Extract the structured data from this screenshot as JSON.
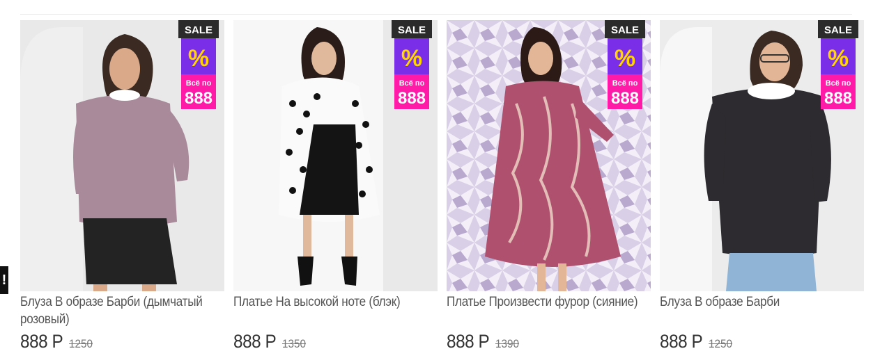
{
  "side_tab": {
    "label": "!"
  },
  "badge": {
    "sale": "SALE",
    "percent": "%",
    "all_for": "Всё по",
    "price": "888"
  },
  "products": [
    {
      "name": "Блуза В образе Барби (дымчатый розовый)",
      "price": "888 Р",
      "old_price": "1250"
    },
    {
      "name": "Платье На высокой ноте (блэк)",
      "price": "888 Р",
      "old_price": "1350"
    },
    {
      "name": "Платье Произвести фурор (сияние)",
      "price": "888 Р",
      "old_price": "1390"
    },
    {
      "name": "Блуза В образе Барби",
      "price": "888 Р",
      "old_price": "1250"
    }
  ],
  "colors": {
    "badge_dark": "#2b2b2b",
    "badge_pink": "#ff1aa8",
    "badge_purple": "#7a2ee8",
    "badge_yellow": "#ffd400"
  }
}
